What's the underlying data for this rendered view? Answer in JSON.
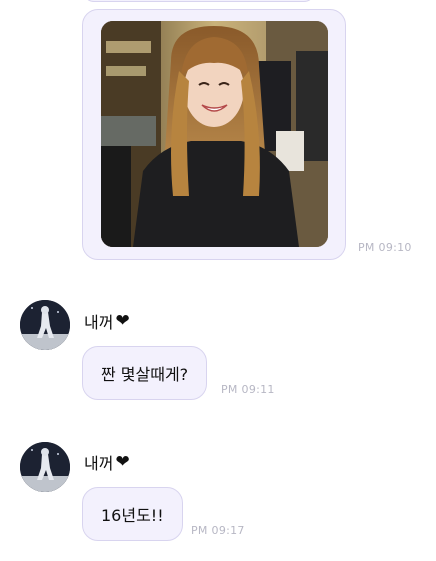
{
  "messages": [
    {
      "type": "image",
      "time": "PM 09:10"
    },
    {
      "type": "text",
      "sender": "내꺼",
      "sender_heart": "❤",
      "text": "짠 몇살때게?",
      "time": "PM 09:11"
    },
    {
      "type": "text",
      "sender": "내꺼",
      "sender_heart": "❤",
      "text": "16년도!!",
      "time": "PM 09:17"
    }
  ],
  "colors": {
    "bubble_bg": "#f3f1fd",
    "bubble_border": "#d8d4ef",
    "timestamp": "#b7b7c4"
  },
  "icons": {
    "heart": "heart-icon",
    "avatar": "avatar"
  }
}
